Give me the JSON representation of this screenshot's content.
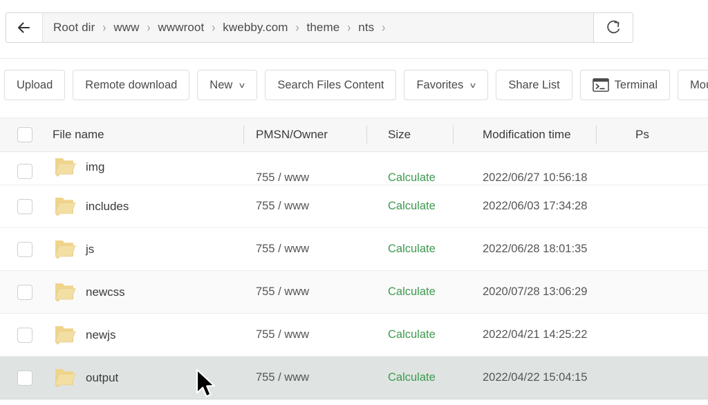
{
  "breadcrumb": {
    "back_icon": "arrow-left-icon",
    "refresh_icon": "refresh-icon",
    "segments": [
      "Root dir",
      "www",
      "wwwroot",
      "kwebby.com",
      "theme",
      "nts"
    ],
    "separator": "›"
  },
  "toolbar": {
    "buttons": [
      {
        "label": "Upload",
        "icon": null,
        "caret": false
      },
      {
        "label": "Remote download",
        "icon": null,
        "caret": false
      },
      {
        "label": "New",
        "icon": null,
        "caret": true
      },
      {
        "label": "Search Files Content",
        "icon": null,
        "caret": false
      },
      {
        "label": "Favorites",
        "icon": null,
        "caret": true
      },
      {
        "label": "Share List",
        "icon": null,
        "caret": false
      },
      {
        "label": "Terminal",
        "icon": "terminal-icon",
        "caret": false
      },
      {
        "label": "Mounted dis",
        "icon": null,
        "caret": false
      }
    ],
    "caret_glyph": "∨"
  },
  "table": {
    "headers": {
      "file_name": "File name",
      "owner": "PMSN/Owner",
      "size": "Size",
      "mtime": "Modification time",
      "ps": "Ps"
    },
    "rows": [
      {
        "name": "img",
        "owner": "755 / www",
        "size": "Calculate",
        "mtime": "2022/06/27 10:56:18",
        "icon": "folder-icon",
        "state": "clipped"
      },
      {
        "name": "includes",
        "owner": "755 / www",
        "size": "Calculate",
        "mtime": "2022/06/03 17:34:28",
        "icon": "folder-icon",
        "state": "normal"
      },
      {
        "name": "js",
        "owner": "755 / www",
        "size": "Calculate",
        "mtime": "2022/06/28 18:01:35",
        "icon": "folder-icon",
        "state": "normal"
      },
      {
        "name": "newcss",
        "owner": "755 / www",
        "size": "Calculate",
        "mtime": "2020/07/28 13:06:29",
        "icon": "folder-icon",
        "state": "alt"
      },
      {
        "name": "newjs",
        "owner": "755 / www",
        "size": "Calculate",
        "mtime": "2022/04/21 14:25:22",
        "icon": "folder-icon",
        "state": "normal"
      },
      {
        "name": "output",
        "owner": "755 / www",
        "size": "Calculate",
        "mtime": "2022/04/22 15:04:15",
        "icon": "folder-icon",
        "state": "hover"
      }
    ]
  },
  "colors": {
    "calculate_link": "#3c9a4e",
    "folder": "#efd48a",
    "header_bg": "#f7f7f7",
    "row_hover": "#dfe4e2",
    "text": "#3a3a3a"
  },
  "cursor": {
    "icon": "mouse-pointer-icon"
  }
}
